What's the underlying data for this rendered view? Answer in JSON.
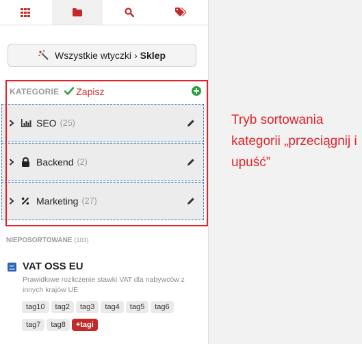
{
  "tabs": [
    {
      "icon": "grid-icon"
    },
    {
      "icon": "folder-icon"
    },
    {
      "icon": "search-icon"
    },
    {
      "icon": "tags-icon"
    }
  ],
  "breadcrumb": {
    "all_label": "Wszystkie wtyczki",
    "separator": "›",
    "current": "Sklep"
  },
  "categories": {
    "title": "KATEGORIE",
    "save_label": "Zapisz",
    "items": [
      {
        "name": "SEO",
        "count": "(25)",
        "icon": "chart-icon"
      },
      {
        "name": "Backend",
        "count": "(2)",
        "icon": "lock-icon"
      },
      {
        "name": "Marketing",
        "count": "(27)",
        "icon": "percent-icon"
      }
    ]
  },
  "annotation": "Tryb sortowania kategorii „przeciągnij i upuść”",
  "unsorted": {
    "title": "NIEPOSORTOWANE",
    "count": "(103)"
  },
  "plugin": {
    "icon_text_1": "VAT",
    "icon_text_2": "OSS",
    "name": "VAT OSS EU",
    "description": "Prawidłowe rozliczenie stawki VAT dla nabywców z innych krajów UE",
    "tags": [
      "tag10",
      "tag2",
      "tag3",
      "tag4",
      "tag5",
      "tag6",
      "tag7",
      "tag8"
    ],
    "more_tags": "+tagi"
  },
  "colors": {
    "accent_red": "#e0222a",
    "save_red": "#d32a2a",
    "add_green": "#2f9e3a",
    "drop_border": "#2f7fc4"
  }
}
